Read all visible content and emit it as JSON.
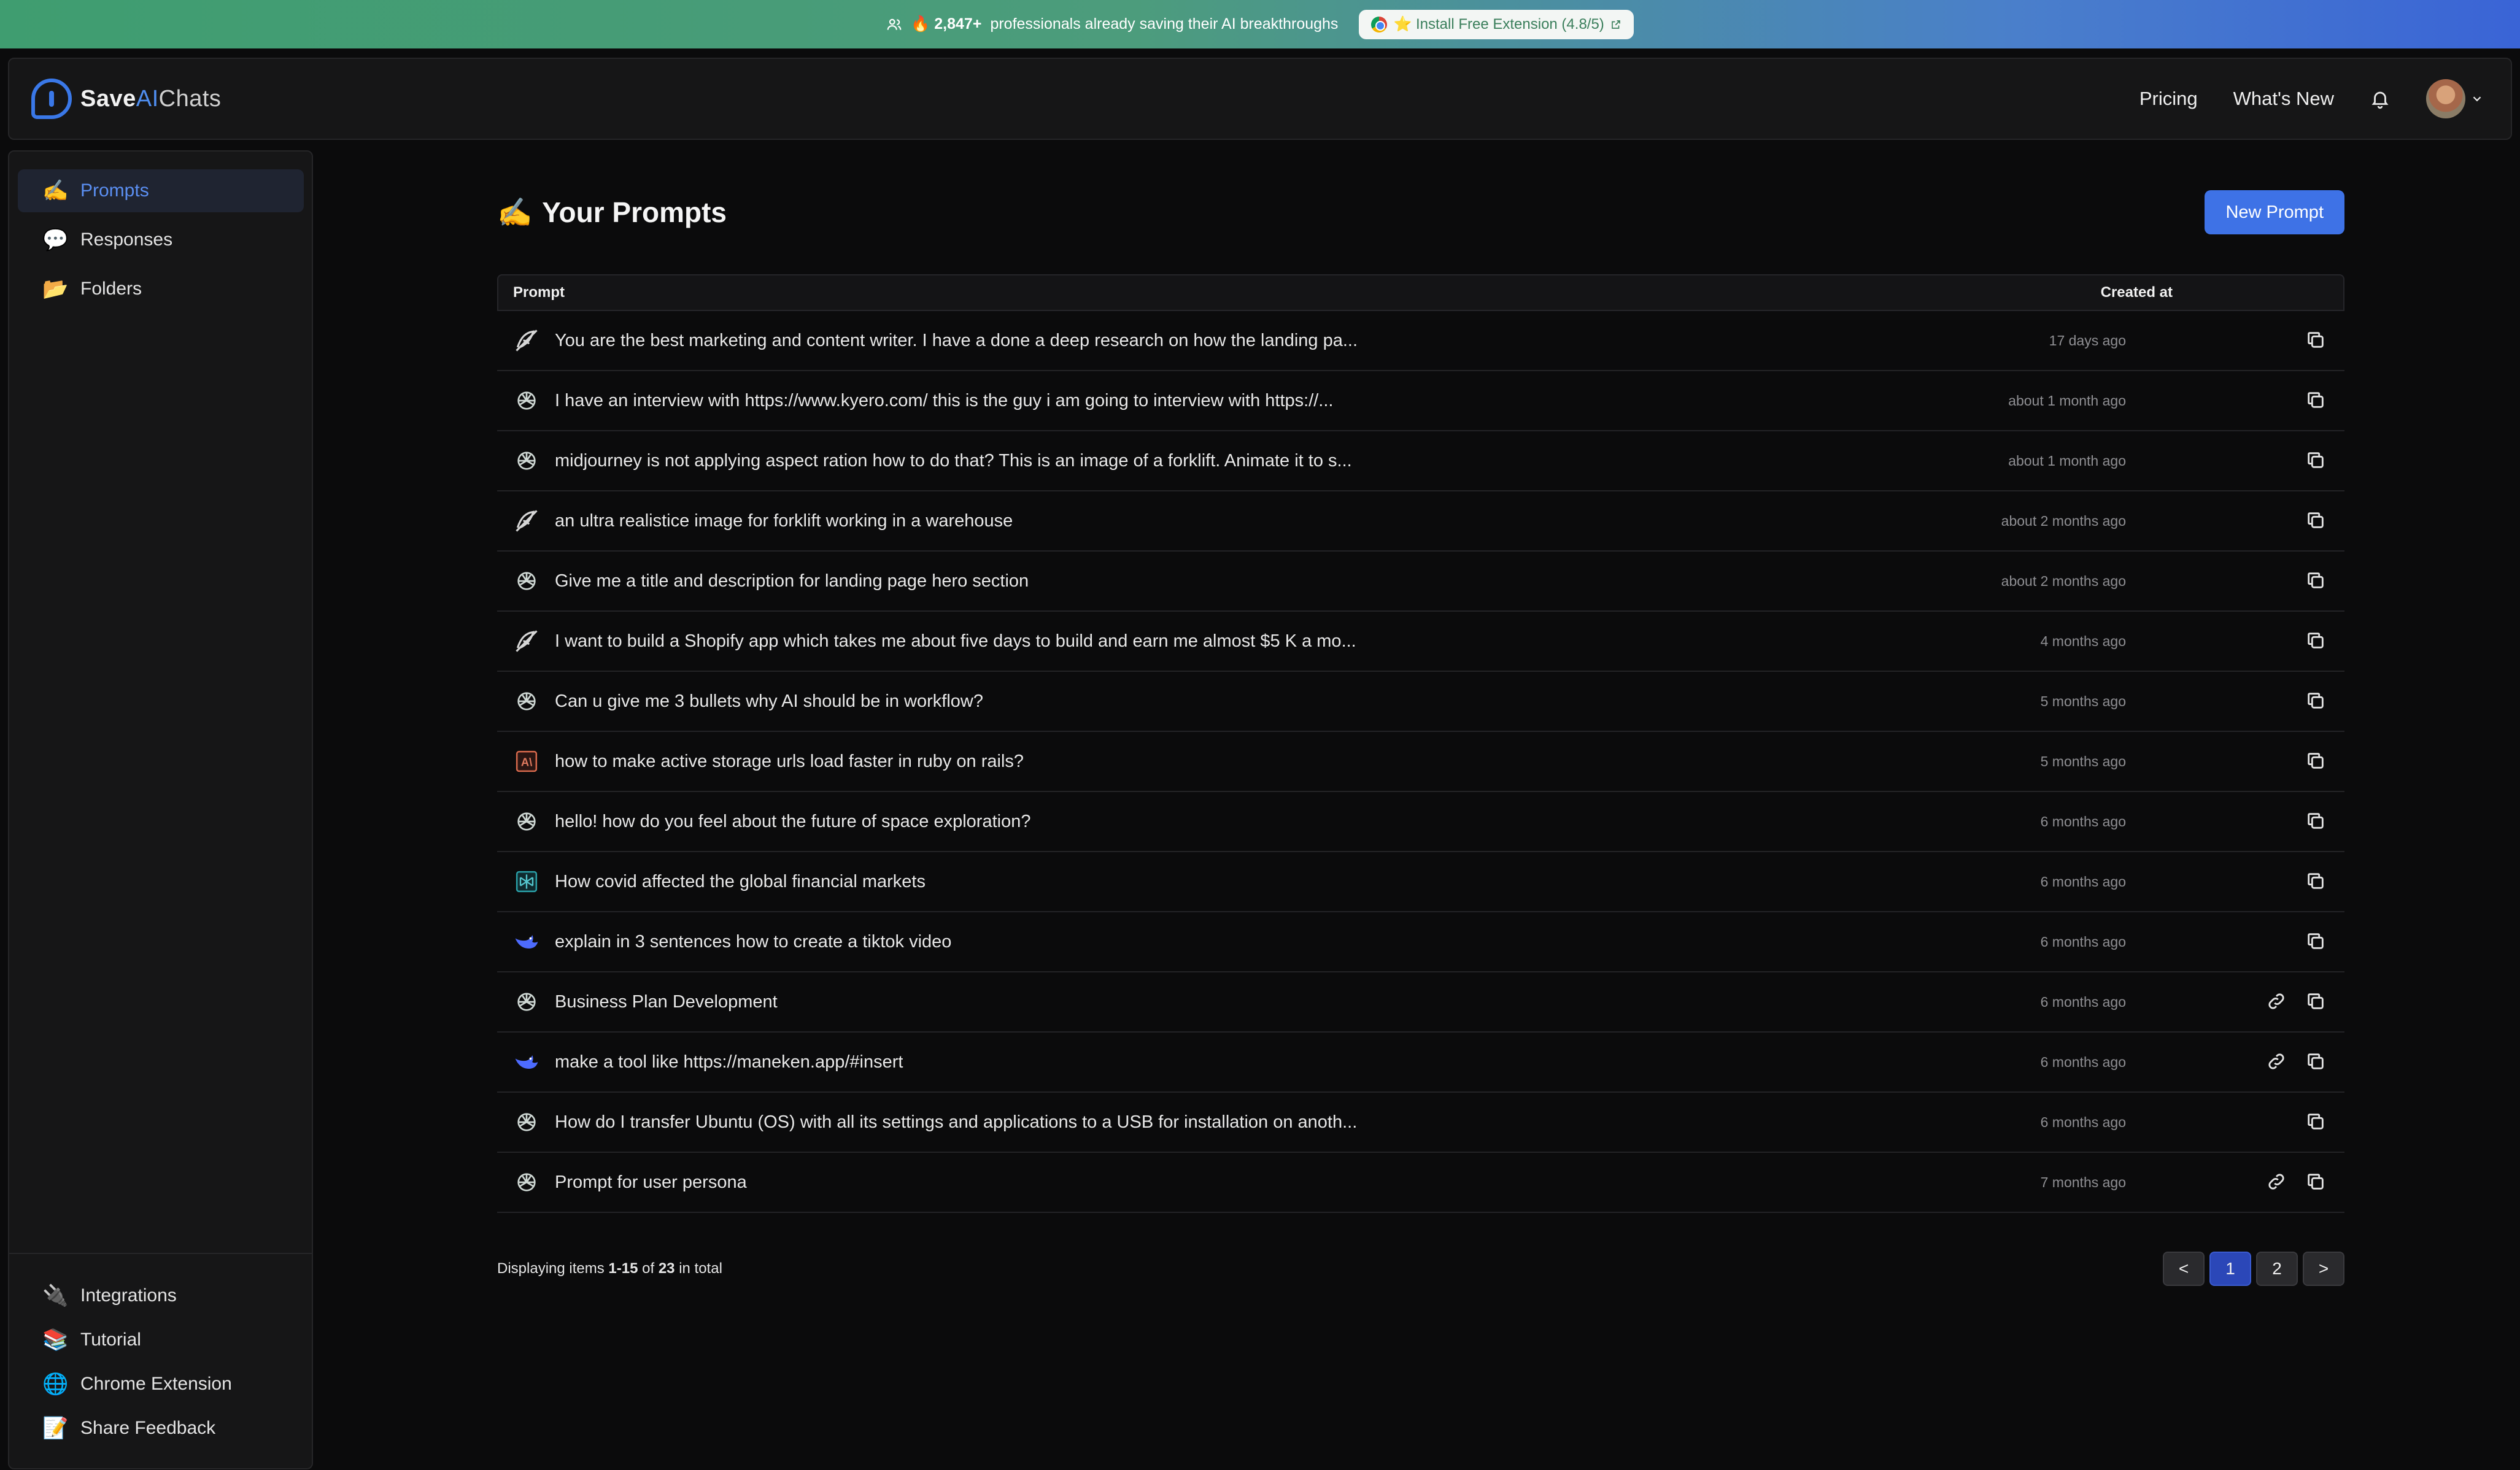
{
  "banner": {
    "text_count": "🔥 2,847+",
    "text_rest": "professionals already saving their AI breakthroughs",
    "cta_label": "⭐ Install Free Extension (4.8/5)"
  },
  "header": {
    "brand_save": "Save",
    "brand_ai": "AI",
    "brand_chats": "Chats",
    "nav": {
      "pricing": "Pricing",
      "whats_new": "What's New"
    }
  },
  "sidebar": {
    "top_items": [
      {
        "emoji": "✍️",
        "label": "Prompts"
      },
      {
        "emoji": "💬",
        "label": "Responses"
      },
      {
        "emoji": "📂",
        "label": "Folders"
      }
    ],
    "bottom_items": [
      {
        "emoji": "🔌",
        "label": "Integrations"
      },
      {
        "emoji": "📚",
        "label": "Tutorial"
      },
      {
        "emoji": "🌐",
        "label": "Chrome Extension"
      },
      {
        "emoji": "📝",
        "label": "Share Feedback"
      }
    ]
  },
  "main": {
    "title_emoji": "✍️",
    "title": "Your Prompts",
    "new_prompt_label": "New Prompt",
    "table": {
      "col_prompt": "Prompt",
      "col_created": "Created at",
      "rows": [
        {
          "source_icon": "midjourney-icon",
          "prompt": "You are the best marketing and content writer. I have a done a deep research on how the landing pa...",
          "created": "17 days ago",
          "link": false
        },
        {
          "source_icon": "chatgpt-icon",
          "prompt": "I have an interview with https://www.kyero.com/ this is the guy i am going to interview with https://...",
          "created": "about 1 month ago",
          "link": false
        },
        {
          "source_icon": "chatgpt-icon",
          "prompt": "midjourney is not applying aspect ration how to do that? This is an image of a forklift. Animate it to s...",
          "created": "about 1 month ago",
          "link": false
        },
        {
          "source_icon": "midjourney-icon",
          "prompt": "an ultra realistice image for forklift working in a warehouse",
          "created": "about 2 months ago",
          "link": false
        },
        {
          "source_icon": "chatgpt-icon",
          "prompt": "Give me a title and description for landing page hero section",
          "created": "about 2 months ago",
          "link": false
        },
        {
          "source_icon": "midjourney-icon",
          "prompt": "I want to build a Shopify app which takes me about five days to build and earn me almost $5 K a mo...",
          "created": "4 months ago",
          "link": false
        },
        {
          "source_icon": "chatgpt-icon",
          "prompt": "Can u give me 3 bullets why AI should be in workflow?",
          "created": "5 months ago",
          "link": false
        },
        {
          "source_icon": "claude-icon",
          "prompt": "how to make active storage urls load faster in ruby on rails?",
          "created": "5 months ago",
          "link": false
        },
        {
          "source_icon": "chatgpt-icon",
          "prompt": "hello! how do you feel about the future of space exploration?",
          "created": "6 months ago",
          "link": false
        },
        {
          "source_icon": "perplexity-icon",
          "prompt": "How covid affected the global financial markets",
          "created": "6 months ago",
          "link": false
        },
        {
          "source_icon": "deepseek-icon",
          "prompt": "explain in 3 sentences how to create a tiktok video",
          "created": "6 months ago",
          "link": false
        },
        {
          "source_icon": "chatgpt-icon",
          "prompt": "Business Plan Development",
          "created": "6 months ago",
          "link": true
        },
        {
          "source_icon": "deepseek-icon",
          "prompt": "make a tool like https://maneken.app/#insert",
          "created": "6 months ago",
          "link": true
        },
        {
          "source_icon": "chatgpt-icon",
          "prompt": "How do I transfer Ubuntu (OS) with all its settings and applications to a USB for installation on anoth...",
          "created": "6 months ago",
          "link": false
        },
        {
          "source_icon": "chatgpt-icon",
          "prompt": "Prompt for user persona",
          "created": "7 months ago",
          "link": true
        }
      ]
    },
    "pagination": {
      "prefix": "Displaying items",
      "range": "1-15",
      "of": "of",
      "total": "23",
      "suffix": "in total",
      "prev": "<",
      "pages": [
        "1",
        "2"
      ],
      "current": "1",
      "next": ">"
    }
  },
  "colors": {
    "accent": "#3e72e6",
    "active_text": "#5b8ff2",
    "background": "#0b0b0c"
  }
}
